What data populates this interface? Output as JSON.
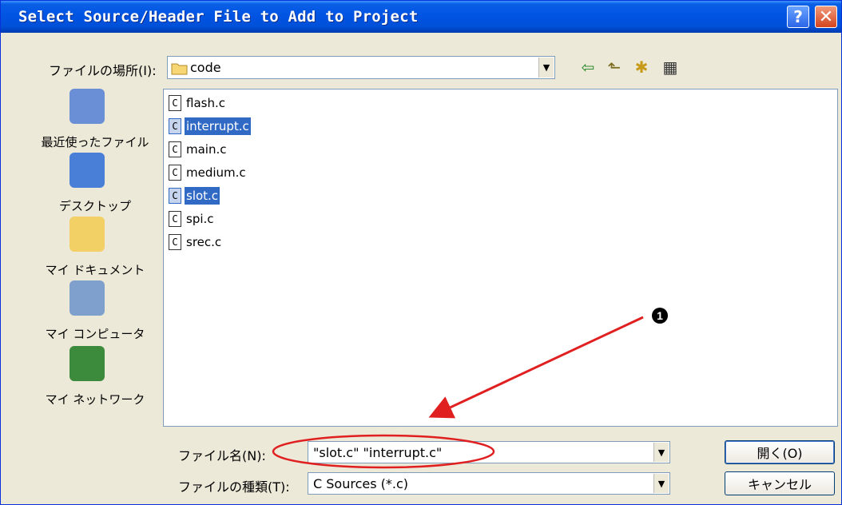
{
  "window": {
    "title": "Select Source/Header File to Add to Project"
  },
  "titlebar": {
    "help_label": "?",
    "close_label": "✕"
  },
  "lookin": {
    "label": "ファイルの場所(I):",
    "value": "code"
  },
  "toolbar": {
    "back_icon": "⇦",
    "up_icon": "⬑",
    "newfolder_icon": "✱",
    "views_icon": "▦"
  },
  "places": [
    {
      "label": "最近使ったファイル",
      "icon": "recent-documents-icon",
      "color": "#6b8fd6"
    },
    {
      "label": "デスクトップ",
      "icon": "desktop-icon",
      "color": "#4a7fd8"
    },
    {
      "label": "マイ ドキュメント",
      "icon": "my-documents-icon",
      "color": "#f2d066"
    },
    {
      "label": "マイ コンピュータ",
      "icon": "my-computer-icon",
      "color": "#7f9fcc"
    },
    {
      "label": "マイ ネットワーク",
      "icon": "my-network-icon",
      "color": "#3c8a3c"
    }
  ],
  "files": [
    {
      "name": "flash.c",
      "selected": false
    },
    {
      "name": "interrupt.c",
      "selected": true
    },
    {
      "name": "main.c",
      "selected": false
    },
    {
      "name": "medium.c",
      "selected": false
    },
    {
      "name": "slot.c",
      "selected": true
    },
    {
      "name": "spi.c",
      "selected": false
    },
    {
      "name": "srec.c",
      "selected": false
    }
  ],
  "file_icon_glyph": "C",
  "filename": {
    "label": "ファイル名(N):",
    "value": "\"slot.c\" \"interrupt.c\""
  },
  "filetype": {
    "label": "ファイルの種類(T):",
    "value": "C Sources (*.c)"
  },
  "buttons": {
    "open": "開く(O)",
    "cancel": "キャンセル"
  },
  "annotation": {
    "number": "1",
    "color": "#e02020"
  },
  "dropdown_glyph": "▼"
}
